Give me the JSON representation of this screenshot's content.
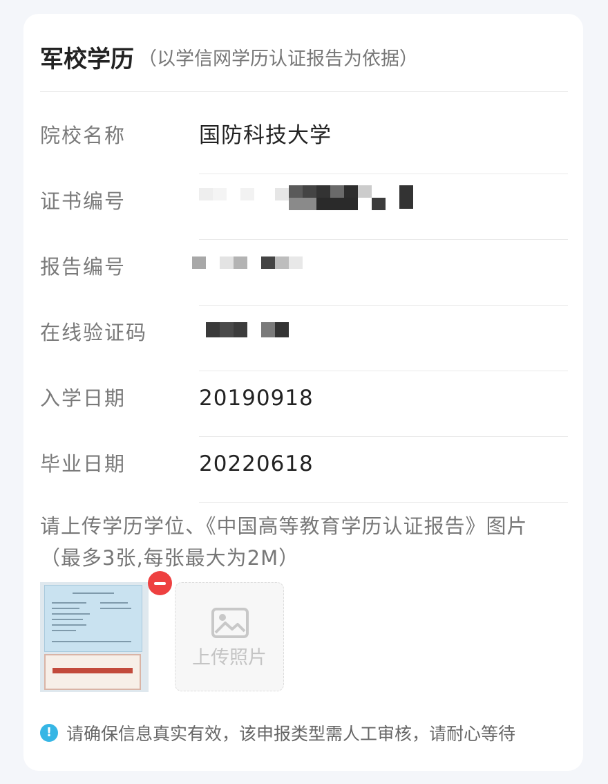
{
  "header": {
    "title": "军校学历",
    "subtitle": "（以学信网学历认证报告为依据）"
  },
  "fields": [
    {
      "label": "院校名称",
      "value": "国防科技大学"
    },
    {
      "label": "证书编号",
      "value": ""
    },
    {
      "label": "报告编号",
      "value": ""
    },
    {
      "label": "在线验证码",
      "value": ""
    },
    {
      "label": "入学日期",
      "value": "20190918"
    },
    {
      "label": "毕业日期",
      "value": "20220618"
    }
  ],
  "upload": {
    "hint": "请上传学历学位、《中国高等教育学历认证报告》图片（最多3张,每张最大为2M）",
    "button_label": "上传照片",
    "uploaded_count": 1,
    "max_count": 3
  },
  "notice": {
    "icon": "info-icon",
    "text": "请确保信息真实有效，该申报类型需人工审核，请耐心等待"
  },
  "colors": {
    "accent_info": "#36b6e5",
    "remove": "#ee4040",
    "label": "#7a7a7a",
    "value": "#222222"
  }
}
